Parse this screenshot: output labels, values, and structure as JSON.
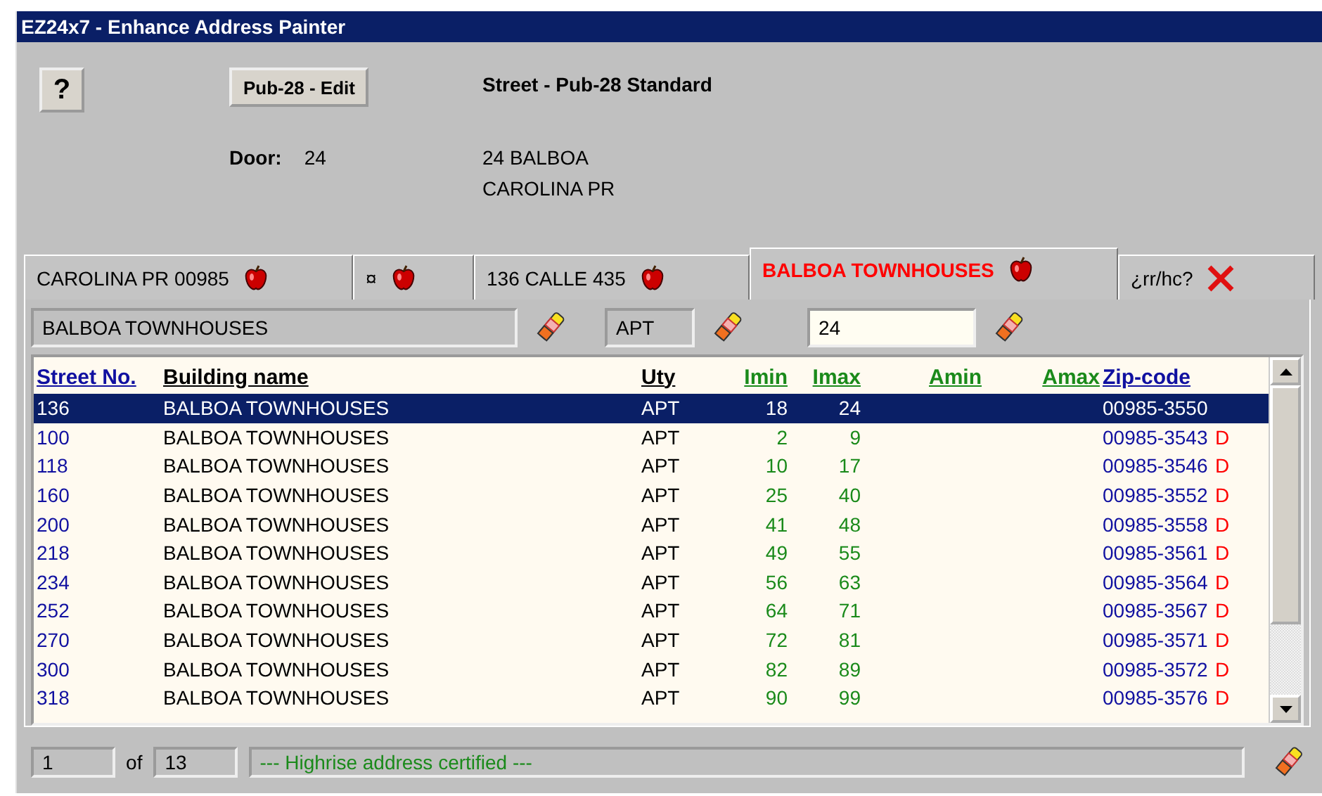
{
  "window": {
    "title": "EZ24x7 - Enhance Address Painter"
  },
  "header": {
    "help_label": "?",
    "edit_button": "Pub-28 - Edit",
    "standard": "Street - Pub-28 Standard",
    "door_label": "Door:",
    "door_value": "24",
    "address_lines": [
      "24  BALBOA",
      "CAROLINA PR"
    ]
  },
  "tabs": [
    {
      "label": "CAROLINA PR 00985",
      "kind": "apple",
      "selected": false
    },
    {
      "label": "¤",
      "kind": "apple",
      "selected": false
    },
    {
      "label": "136 CALLE 435",
      "kind": "apple",
      "selected": false
    },
    {
      "label": "BALBOA TOWNHOUSES",
      "kind": "apple",
      "selected": true
    },
    {
      "label": "¿rr/hc?",
      "kind": "close",
      "selected": false
    }
  ],
  "filters": {
    "building": "BALBOA TOWNHOUSES",
    "unit_type": "APT",
    "number": "24"
  },
  "table": {
    "columns": [
      {
        "label": "Street No.",
        "kind": "link"
      },
      {
        "label": "Building name",
        "kind": "plain"
      },
      {
        "label": "Uty",
        "kind": "plain"
      },
      {
        "label": "Imin",
        "kind": "green"
      },
      {
        "label": "Imax",
        "kind": "green"
      },
      {
        "label": "Amin",
        "kind": "green"
      },
      {
        "label": "Amax",
        "kind": "green"
      },
      {
        "label": "Zip-code",
        "kind": "link"
      }
    ],
    "rows": [
      {
        "street": "136",
        "building": "BALBOA TOWNHOUSES",
        "uty": "APT",
        "imin": "18",
        "imax": "24",
        "zip": "00985-3550",
        "selected": true
      },
      {
        "street": "100",
        "building": "BALBOA TOWNHOUSES",
        "uty": "APT",
        "imin": "2",
        "imax": "9",
        "zip": "00985-3543",
        "flag": "D",
        "selected": false
      },
      {
        "street": "118",
        "building": "BALBOA TOWNHOUSES",
        "uty": "APT",
        "imin": "10",
        "imax": "17",
        "zip": "00985-3546",
        "flag": "D",
        "selected": false
      },
      {
        "street": "160",
        "building": "BALBOA TOWNHOUSES",
        "uty": "APT",
        "imin": "25",
        "imax": "40",
        "zip": "00985-3552",
        "flag": "D",
        "selected": false
      },
      {
        "street": "200",
        "building": "BALBOA TOWNHOUSES",
        "uty": "APT",
        "imin": "41",
        "imax": "48",
        "zip": "00985-3558",
        "flag": "D",
        "selected": false
      },
      {
        "street": "218",
        "building": "BALBOA TOWNHOUSES",
        "uty": "APT",
        "imin": "49",
        "imax": "55",
        "zip": "00985-3561",
        "flag": "D",
        "selected": false
      },
      {
        "street": "234",
        "building": "BALBOA TOWNHOUSES",
        "uty": "APT",
        "imin": "56",
        "imax": "63",
        "zip": "00985-3564",
        "flag": "D",
        "selected": false
      },
      {
        "street": "252",
        "building": "BALBOA TOWNHOUSES",
        "uty": "APT",
        "imin": "64",
        "imax": "71",
        "zip": "00985-3567",
        "flag": "D",
        "selected": false
      },
      {
        "street": "270",
        "building": "BALBOA TOWNHOUSES",
        "uty": "APT",
        "imin": "72",
        "imax": "81",
        "zip": "00985-3571",
        "flag": "D",
        "selected": false
      },
      {
        "street": "300",
        "building": "BALBOA TOWNHOUSES",
        "uty": "APT",
        "imin": "82",
        "imax": "89",
        "zip": "00985-3572",
        "flag": "D",
        "selected": false
      },
      {
        "street": "318",
        "building": "BALBOA TOWNHOUSES",
        "uty": "APT",
        "imin": "90",
        "imax": "99",
        "zip": "00985-3576",
        "flag": "D",
        "selected": false
      }
    ]
  },
  "status_bar": {
    "record": "1",
    "of_label": "of",
    "total": "13",
    "message": "--- Highrise address certified ---"
  }
}
